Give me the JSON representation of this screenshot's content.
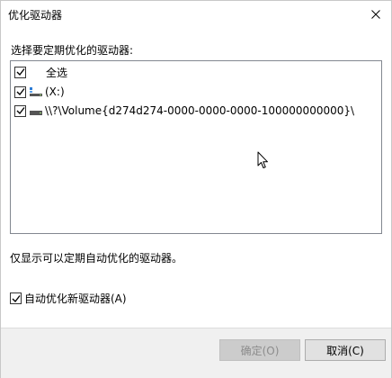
{
  "window": {
    "title": "优化驱动器"
  },
  "prompt": {
    "label": "选择要定期优化的驱动器:"
  },
  "drive_list": {
    "select_all": {
      "label": "全选",
      "checked": true
    },
    "items": [
      {
        "label": "(X:)",
        "checked": true,
        "icon": "usb-drive-icon"
      },
      {
        "label": "\\\\?\\Volume{d274d274-0000-0000-0000-100000000000}\\",
        "checked": true,
        "icon": "hard-drive-icon"
      }
    ]
  },
  "info": {
    "text": "仅显示可以定期自动优化的驱动器。"
  },
  "auto_optimize": {
    "label": "自动优化新驱动器(A)",
    "checked": true
  },
  "buttons": {
    "ok_label": "确定(O)",
    "ok_enabled": false,
    "cancel_label": "取消(C)"
  },
  "colors": {
    "usb_icon_accent": "#2b7bd6",
    "drive_icon": "#555555",
    "footer_bg": "#f0f0f0"
  }
}
